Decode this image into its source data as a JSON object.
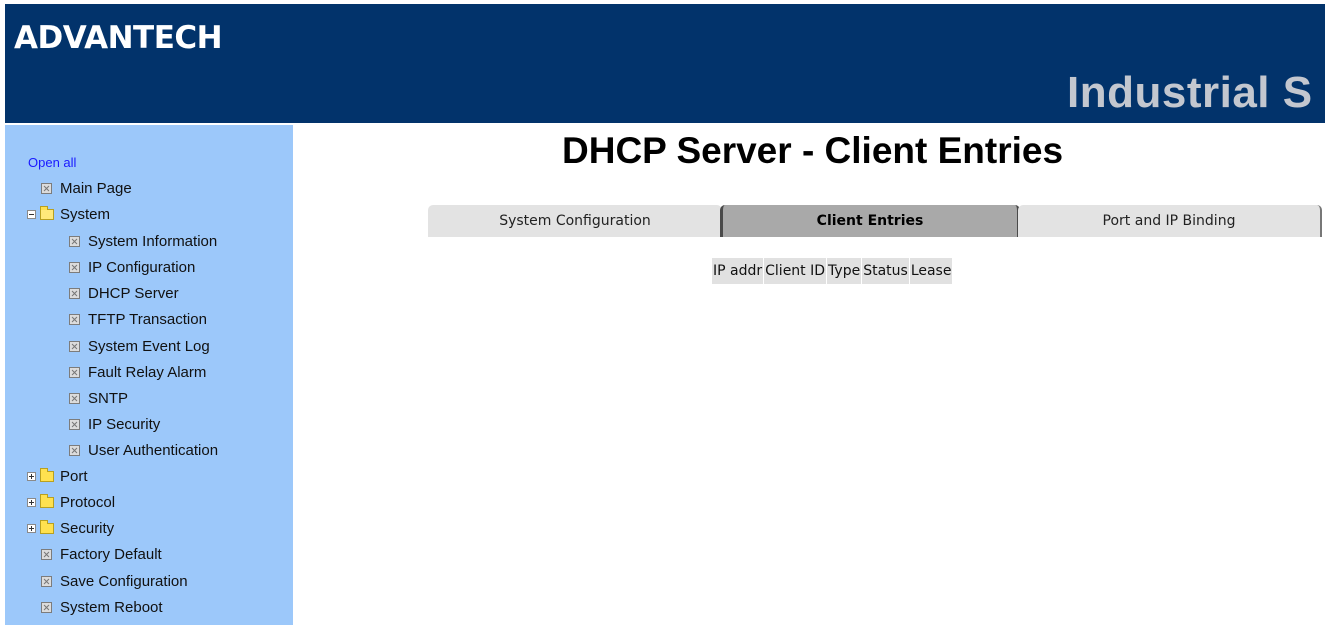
{
  "header": {
    "logo": "ADVANTECH",
    "banner": "Industrial S"
  },
  "sidebar": {
    "open_all": "Open all",
    "main_page": "Main Page",
    "system": {
      "label": "System",
      "items": [
        {
          "label": "System Information"
        },
        {
          "label": "IP Configuration"
        },
        {
          "label": "DHCP Server"
        },
        {
          "label": "TFTP Transaction"
        },
        {
          "label": "System Event Log"
        },
        {
          "label": "Fault Relay Alarm"
        },
        {
          "label": "SNTP"
        },
        {
          "label": "IP Security"
        },
        {
          "label": "User Authentication"
        }
      ]
    },
    "folders": [
      {
        "label": "Port"
      },
      {
        "label": "Protocol"
      },
      {
        "label": "Security"
      }
    ],
    "actions": [
      {
        "label": "Factory Default"
      },
      {
        "label": "Save Configuration"
      },
      {
        "label": "System Reboot"
      }
    ]
  },
  "main": {
    "title": "DHCP Server - Client Entries",
    "tabs": [
      {
        "label": "System Configuration",
        "active": false
      },
      {
        "label": "Client Entries",
        "active": true
      },
      {
        "label": "Port and IP Binding",
        "active": false
      }
    ],
    "table": {
      "columns": [
        "IP addr",
        "Client ID",
        "Type",
        "Status",
        "Lease"
      ]
    }
  },
  "colors": {
    "header_bg": "#02336b",
    "sidebar_bg": "#9cc8fa",
    "tab_bg": "#e3e3e3",
    "tab_active_bg": "#a9a9a9"
  }
}
